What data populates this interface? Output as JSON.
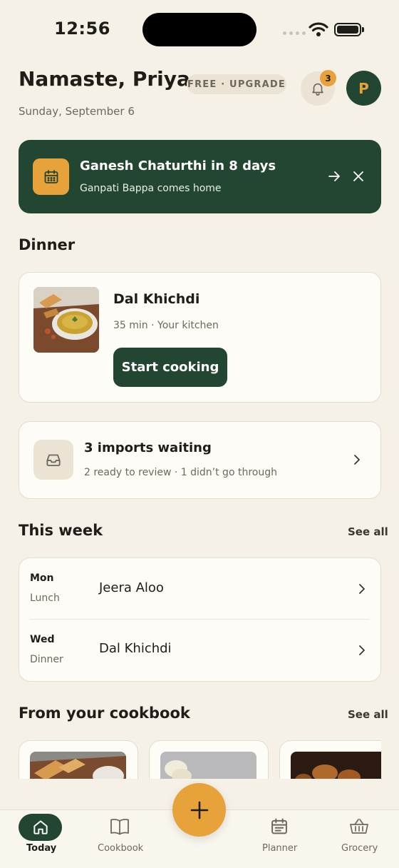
{
  "status_bar": {
    "time": "12:56"
  },
  "header": {
    "greeting": "Namaste, Priya",
    "date": "Sunday, September 6",
    "plan_badge": "FREE · UPGRADE",
    "notification_count": "3",
    "avatar_initial": "P"
  },
  "festival_banner": {
    "title": "Ganesh Chaturthi in 8 days",
    "subtitle": "Ganpati Bappa comes home"
  },
  "dinner": {
    "heading": "Dinner",
    "dish": "Dal Khichdi",
    "meta": "35 min · Your kitchen",
    "button": "Start cooking"
  },
  "imports": {
    "title": "3 imports waiting",
    "subtitle": "2 ready to review · 1 didn’t go through"
  },
  "this_week": {
    "heading": "This week",
    "see_all": "See all",
    "rows": [
      {
        "day": "Mon",
        "meal": "Lunch",
        "dish": "Jeera Aloo"
      },
      {
        "day": "Wed",
        "meal": "Dinner",
        "dish": "Dal Khichdi"
      }
    ]
  },
  "cookbook": {
    "heading": "From your cookbook",
    "see_all": "See all"
  },
  "tabs": [
    {
      "label": "Today",
      "icon": "home-icon"
    },
    {
      "label": "Cookbook",
      "icon": "book-icon"
    },
    {
      "label": "Planner",
      "icon": "calendar-icon"
    },
    {
      "label": "Grocery",
      "icon": "basket-icon"
    }
  ],
  "colors": {
    "background": "#f5f1e7",
    "primary_green": "#234633",
    "accent_saffron": "#e8a23a",
    "muted_text": "#6e685c"
  }
}
